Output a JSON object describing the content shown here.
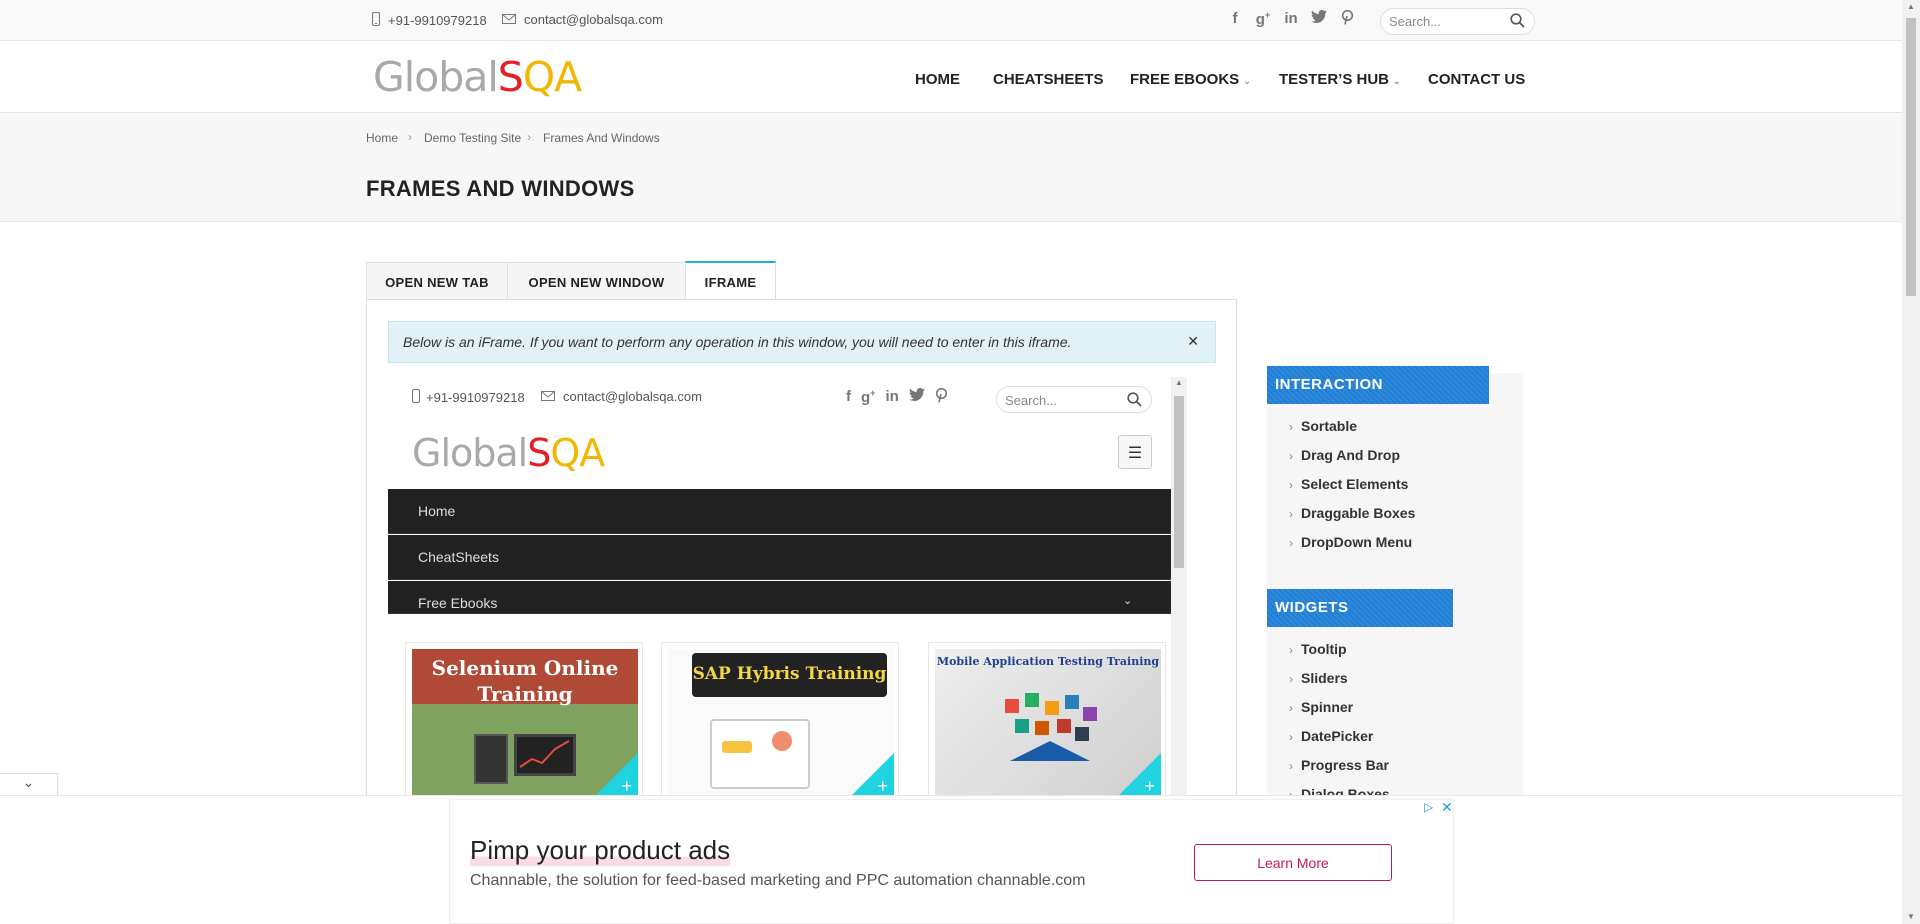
{
  "topbar": {
    "phone": "+91-9910979218",
    "email": "contact@globalsqa.com",
    "social_icons": [
      "facebook-icon",
      "google-plus-icon",
      "linkedin-icon",
      "twitter-icon",
      "pinterest-icon"
    ],
    "search_placeholder": "Search..."
  },
  "logo": {
    "part1": "Global",
    "part2": "S",
    "part3": "QA"
  },
  "nav": {
    "home": "HOME",
    "cheatsheets": "CHEATSHEETS",
    "free_ebooks": "FREE EBOOKS",
    "testers_hub": "TESTER’S HUB",
    "contact_us": "CONTACT US"
  },
  "breadcrumb": {
    "home": "Home",
    "demo": "Demo Testing Site",
    "current": "Frames And Windows"
  },
  "page_title": "FRAMES AND WINDOWS",
  "tabs": {
    "open_new_tab": "OPEN NEW TAB",
    "open_new_window": "OPEN NEW WINDOW",
    "iframe": "IFRAME"
  },
  "info_text": "Below is an iFrame. If you want to perform any operation in this window, you will need to enter in this iframe.",
  "iframe": {
    "phone": "+91-9910979218",
    "email": "contact@globalsqa.com",
    "search_placeholder": "Search...",
    "menu": [
      "Home",
      "CheatSheets",
      "Free Ebooks"
    ],
    "cards": [
      {
        "title_line1": "Selenium Online",
        "title_line2": "Training"
      },
      {
        "title": "SAP Hybris Training"
      },
      {
        "title": "Mobile Application Testing Training"
      }
    ]
  },
  "sidebar": {
    "interaction_title": "INTERACTION",
    "interaction_items": [
      "Sortable",
      "Drag And Drop",
      "Select Elements",
      "Draggable Boxes",
      "DropDown Menu"
    ],
    "widgets_title": "WIDGETS",
    "widgets_items": [
      "Tooltip",
      "Sliders",
      "Spinner",
      "DatePicker",
      "Progress Bar",
      "Dialog Boxes"
    ]
  },
  "ad": {
    "title": "Pimp your product ads",
    "text": "Channable, the solution for feed-based marketing and PPC automation channable.com",
    "button": "Learn More"
  },
  "colors": {
    "accent": "#1eaee0",
    "sidebar_head": "#1f7ed6",
    "info_bg": "#e0f2f6",
    "ad_button": "#c2185b"
  }
}
